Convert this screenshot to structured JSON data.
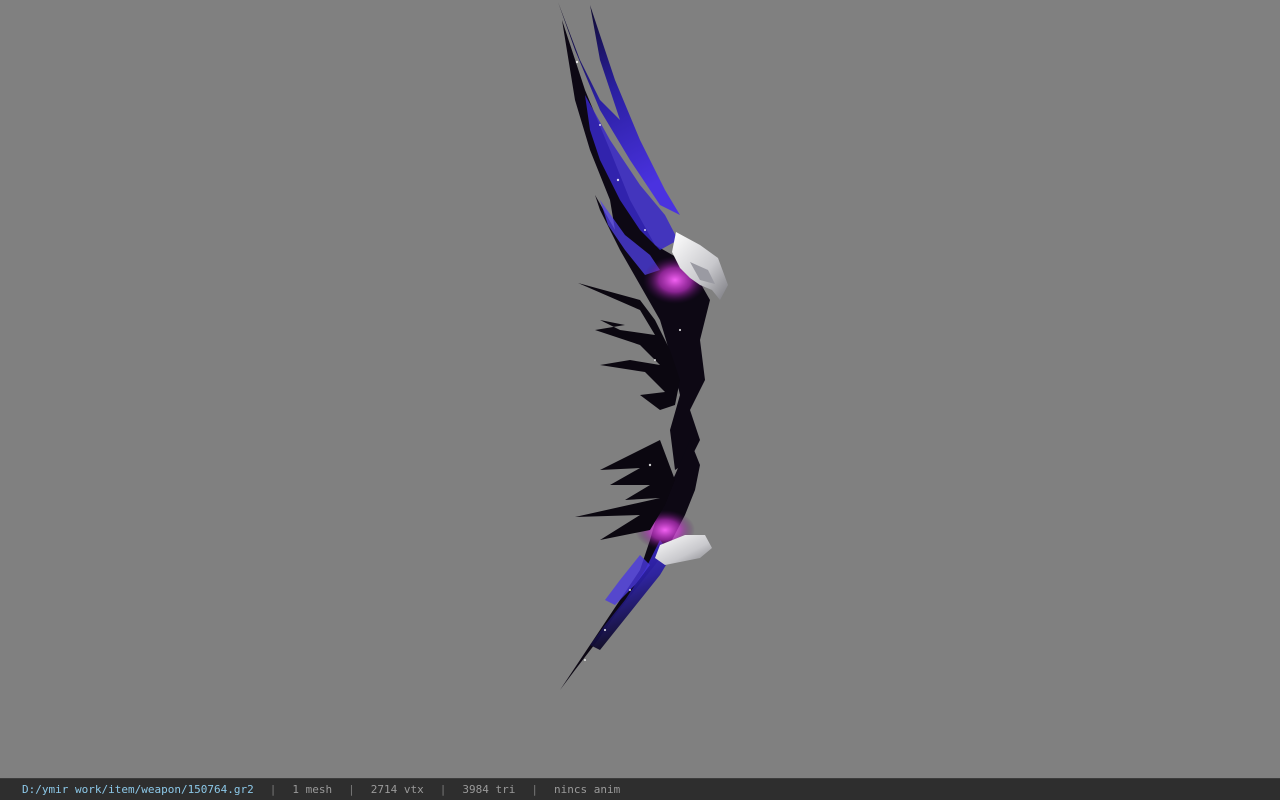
{
  "viewer": {
    "background_color": "#808080",
    "model": {
      "description_icon": "bow-weapon-3d-model",
      "colors": {
        "dark": "#0b0710",
        "blue": "#3a2ad0",
        "magenta": "#d03ad0",
        "silver": "#d8d8dc"
      }
    }
  },
  "status_bar": {
    "file_path": "D:/ymir work/item/weapon/150764.gr2",
    "sep": "|",
    "mesh_count": "1 mesh",
    "vertex_count": "2714 vtx",
    "triangle_count": "3984 tri",
    "anim_status": "nincs anim"
  }
}
